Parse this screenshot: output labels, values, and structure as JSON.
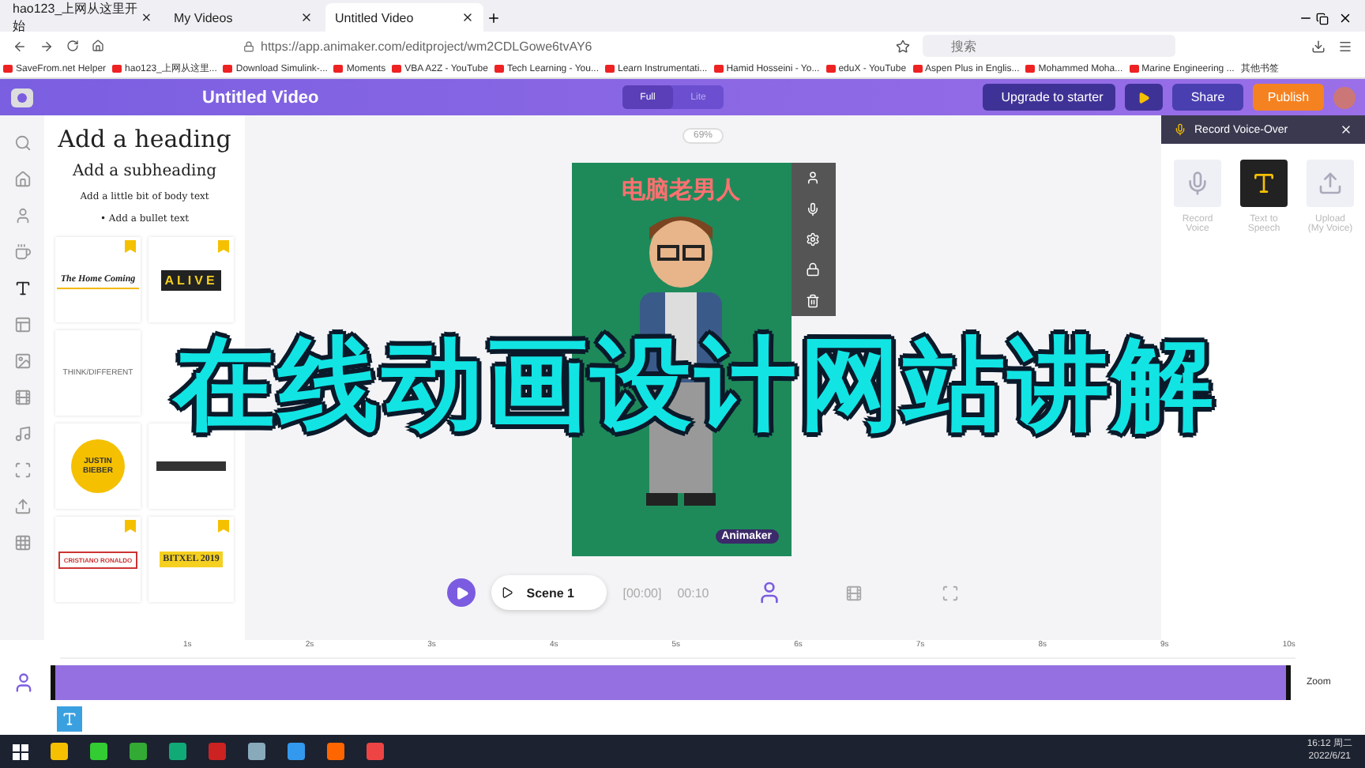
{
  "browser": {
    "tabs": [
      {
        "title": "hao123_上网从这里开始",
        "selected": false
      },
      {
        "title": "My Videos",
        "selected": false
      },
      {
        "title": "Untitled Video",
        "selected": true
      }
    ],
    "url": "https://app.animaker.com/editproject/wm2CDLGowe6tvAY6",
    "search": {
      "placeholder": "搜索"
    },
    "bookmarks": [
      "SaveFrom.net Helper",
      "hao123_上网从这里...",
      "Download Simulink-...",
      "Moments",
      "VBA A2Z - YouTube",
      "Tech Learning - You...",
      "Learn Instrumentati...",
      "Hamid Hosseini - Yo...",
      "eduX - YouTube",
      "Aspen Plus in Englis...",
      "Mohammed Moha...",
      "Marine Engineering ..."
    ],
    "other_bookmarks": "其他书签"
  },
  "app": {
    "title": "Untitled Video",
    "modes": [
      {
        "label": "Full",
        "selected": true
      },
      {
        "label": "Lite",
        "selected": false
      }
    ],
    "upgrade": "Upgrade to starter",
    "share": "Share",
    "publish": "Publish"
  },
  "text_panel": {
    "heading": "Add a heading",
    "subheading": "Add a subheading",
    "body": "Add a little bit of body text",
    "bullet": "• Add a bullet text",
    "templates": [
      {
        "kind": "underline",
        "text": "The Home Coming",
        "premium": true
      },
      {
        "kind": "dark",
        "text": "ALIVE",
        "premium": true
      },
      {
        "kind": "plain",
        "text": "THINK/DIFFERENT",
        "premium": false
      },
      {
        "kind": "covered"
      },
      {
        "kind": "circle",
        "text": "JUSTIN BIEBER",
        "premium": false
      },
      {
        "kind": "darkbar",
        "premium": false
      },
      {
        "kind": "boxed",
        "text": "CRISTIANO RONALDO",
        "premium": true
      },
      {
        "kind": "yellow",
        "text": "BITXEL 2019",
        "premium": true
      }
    ]
  },
  "canvas": {
    "zoom": "69%",
    "caption": "电脑老男人",
    "brand": "Animaker"
  },
  "scene_bar": {
    "scene": "Scene 1",
    "current": "[00:00]",
    "duration": "00:10"
  },
  "voice_panel": {
    "title": "Record Voice-Over",
    "options": [
      {
        "label": "Record Voice",
        "selected": false
      },
      {
        "label": "Text to Speech",
        "selected": true
      },
      {
        "label": "Upload (My Voice)",
        "selected": false
      }
    ]
  },
  "timeline": {
    "ticks": [
      "1s",
      "2s",
      "3s",
      "4s",
      "5s",
      "6s",
      "7s",
      "8s",
      "9s",
      "10s"
    ],
    "zoom": "Zoom"
  },
  "taskbar": {
    "time": "16:12 周二",
    "date": "2022/6/21"
  },
  "overlay_title": "在线动画设计网站讲解"
}
